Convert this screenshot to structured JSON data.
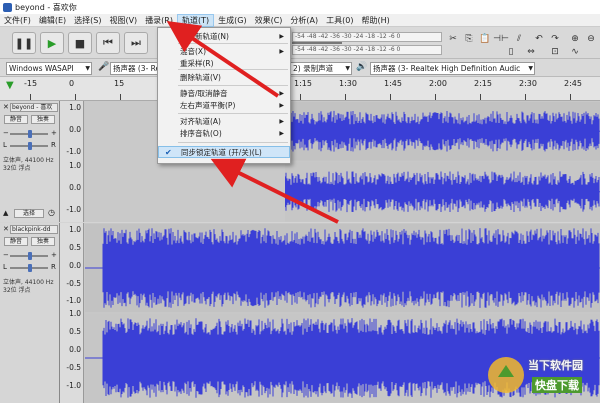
{
  "window": {
    "title": "beyond - 喜欢你"
  },
  "menu": [
    {
      "label": "文件(F)"
    },
    {
      "label": "编辑(E)"
    },
    {
      "label": "选择(S)"
    },
    {
      "label": "视图(V)"
    },
    {
      "label": "播录(R)"
    },
    {
      "label": "轨道(T)"
    },
    {
      "label": "生成(G)"
    },
    {
      "label": "效果(C)"
    },
    {
      "label": "分析(A)"
    },
    {
      "label": "工具(0)"
    },
    {
      "label": "帮助(H)"
    }
  ],
  "toolbar": {
    "pause": "pause-icon",
    "play": "play-icon",
    "stop": "stop-icon",
    "skip_start": "skip-start-icon",
    "skip_end": "skip-end-icon",
    "record": "record-icon",
    "meter_db": "-18"
  },
  "device": {
    "host": "Windows WASAPI",
    "mic": "扬声器 (3- Realt",
    "channels": "2) 录制声道",
    "output": "扬声器 (3- Realtek High Definition Audic"
  },
  "ruler": {
    "ticks": [
      "-15",
      "0",
      "15",
      "30",
      "45",
      "1:00",
      "1:15",
      "1:30",
      "1:45",
      "2:00",
      "2:15",
      "2:30",
      "2:45"
    ]
  },
  "tracks": [
    {
      "name": "beyond - 喜欢",
      "mute": "静音",
      "solo": "独奏",
      "info1": "立体声, 44100 Hz",
      "info2": "32位 浮点",
      "select": "选择",
      "scale": [
        "1.0",
        "0.0",
        "-1.0",
        "1.0",
        "0.0",
        "-1.0"
      ]
    },
    {
      "name": "blackpink-dd",
      "mute": "静音",
      "solo": "独奏",
      "info1": "立体声, 44100 Hz",
      "info2": "32位 浮点",
      "select": "选择",
      "scale": [
        "1.0",
        "0.5",
        "0.0",
        "-0.5",
        "-1.0",
        "1.0",
        "0.5",
        "0.0",
        "-0.5",
        "-1.0"
      ]
    }
  ],
  "track_menu": {
    "items": [
      {
        "label": "添加新轨道(N)",
        "has_sub": true
      },
      {
        "label": "混音(X)",
        "has_sub": true
      },
      {
        "label": "重采样(R)",
        "has_sub": false
      },
      {
        "label": "删除轨道(V)",
        "has_sub": false
      },
      {
        "label": "静音/取消静音",
        "has_sub": true
      },
      {
        "label": "左右声道平衡(P)",
        "has_sub": true
      },
      {
        "label": "对齐轨道(A)",
        "has_sub": true
      },
      {
        "label": "排序音轨(O)",
        "has_sub": true
      },
      {
        "label": "同步锁定轨道 (开/关)(L)",
        "has_sub": false,
        "checked": true
      }
    ]
  },
  "watermark": {
    "text1": "当下软件园",
    "text2": "快盘下载"
  },
  "colors": {
    "waveform": "#3a3fd6",
    "waveform_selected": "#2f33c0",
    "menu_highlight": "#cfe5f8",
    "arrow": "#e02020"
  }
}
